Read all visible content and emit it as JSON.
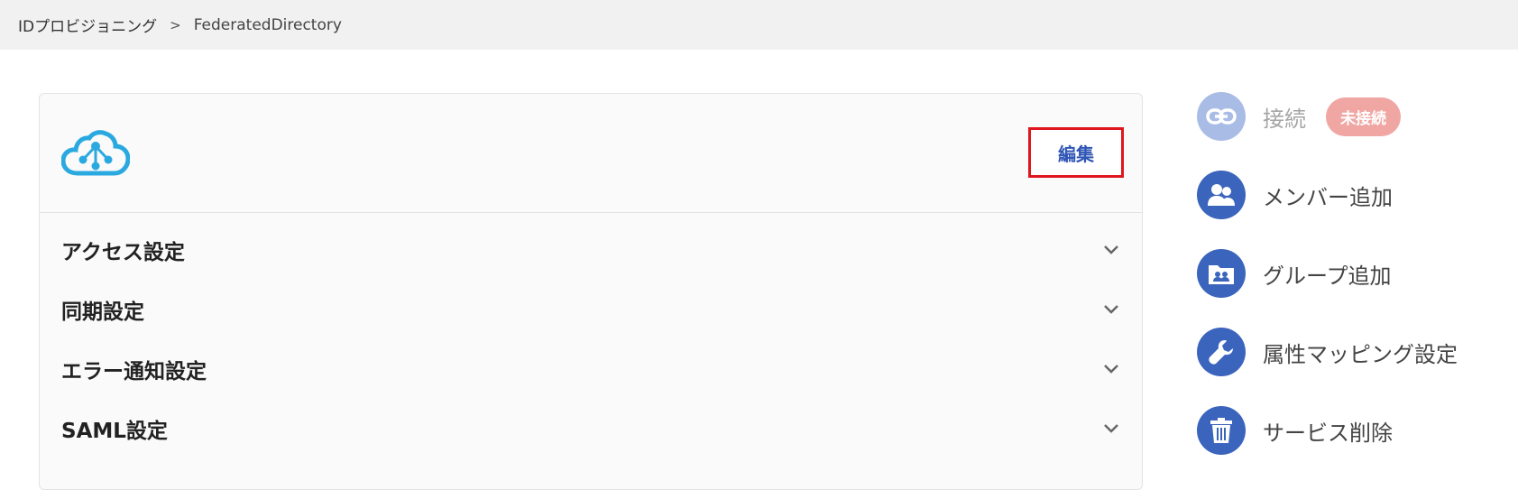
{
  "breadcrumb": {
    "root": "IDプロビジョニング",
    "separator": ">",
    "current": "FederatedDirectory"
  },
  "card": {
    "logo_icon": "federated-directory-cloud-logo",
    "edit_label": "編集",
    "sections": [
      {
        "title": "アクセス設定"
      },
      {
        "title": "同期設定"
      },
      {
        "title": "エラー通知設定"
      },
      {
        "title": "SAML設定"
      }
    ]
  },
  "actions": {
    "connect": {
      "label": "接続",
      "icon": "link-icon",
      "status_badge": "未接続"
    },
    "add_member": {
      "label": "メンバー追加",
      "icon": "users-icon"
    },
    "add_group": {
      "label": "グループ追加",
      "icon": "group-folder-icon"
    },
    "attribute_mapping": {
      "label": "属性マッピング設定",
      "icon": "wrench-icon"
    },
    "delete_service": {
      "label": "サービス削除",
      "icon": "trash-icon"
    }
  },
  "colors": {
    "accent": "#3b64bd",
    "accent_disabled": "#a9bce6",
    "badge_bg": "#f0a7a3",
    "highlight_border": "#e0161f",
    "logo": "#2aa9e0"
  }
}
